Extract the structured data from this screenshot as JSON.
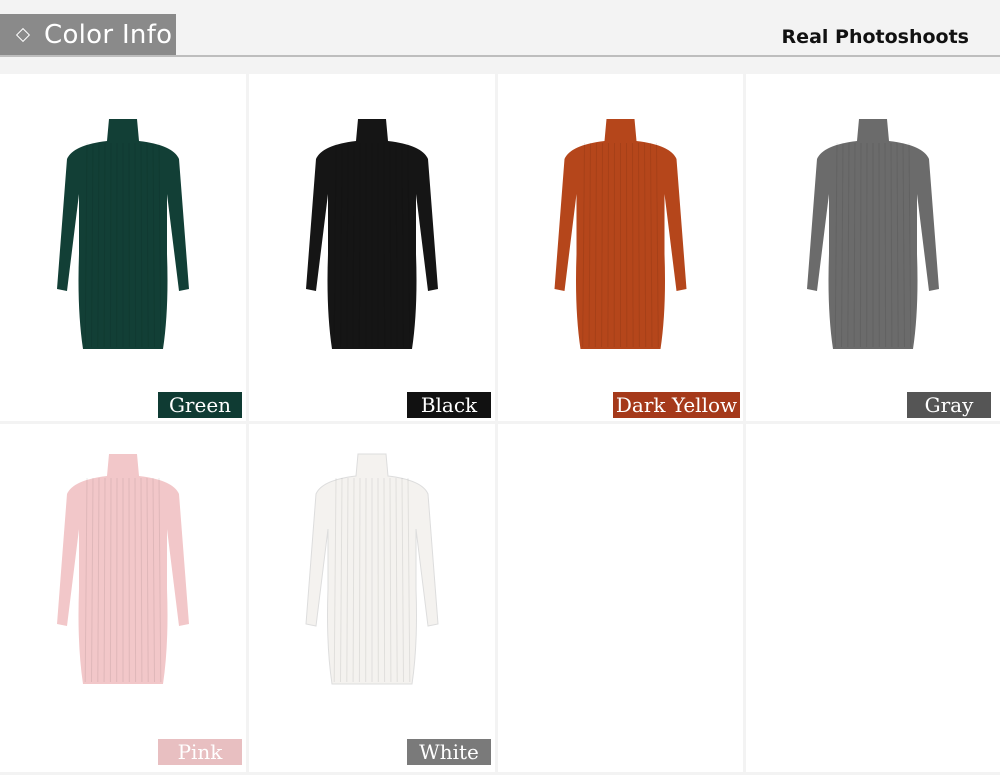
{
  "header": {
    "tab_label": "Color Info",
    "right_title": "Real Photoshoots"
  },
  "colors": [
    {
      "name": "Green",
      "dress": "#123f36",
      "label_bg": "#0f3b33",
      "label_fg": "#ffffff"
    },
    {
      "name": "Black",
      "dress": "#151515",
      "label_bg": "#111111",
      "label_fg": "#ffffff"
    },
    {
      "name": "Dark Yellow",
      "dress": "#b5461b",
      "label_bg": "#a5391a",
      "label_fg": "#ffffff"
    },
    {
      "name": "Gray",
      "dress": "#6b6b6b",
      "label_bg": "#555555",
      "label_fg": "#ffffff"
    },
    {
      "name": "Pink",
      "dress": "#f2c7c9",
      "label_bg": "#e8bfc1",
      "label_fg": "#ffffff"
    },
    {
      "name": "White",
      "dress": "#f4f2ef",
      "label_bg": "#7a7a7a",
      "label_fg": "#ffffff"
    }
  ]
}
